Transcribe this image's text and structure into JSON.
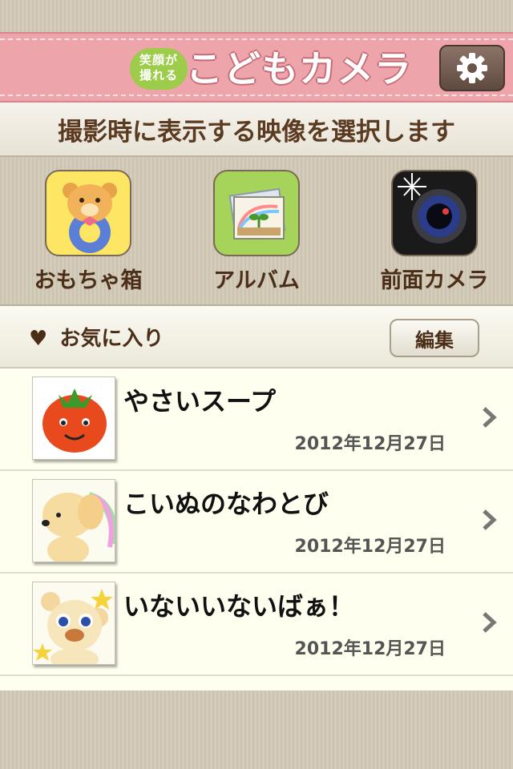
{
  "header": {
    "logo_badge": "笑顔が撮れる",
    "logo_badge_line1": "笑顔が",
    "logo_badge_line2": "撮れる",
    "app_title": "こどもカメラ"
  },
  "banner": {
    "text": "撮影時に表示する映像を選択します"
  },
  "sources": [
    {
      "label": "おもちゃ箱",
      "icon": "toybox-bear-icon"
    },
    {
      "label": "アルバム",
      "icon": "album-photos-icon"
    },
    {
      "label": "前面カメラ",
      "icon": "camera-lens-icon"
    }
  ],
  "favorites": {
    "title": "お気に入り",
    "edit_label": "編集",
    "items": [
      {
        "title": "やさいスープ",
        "date": "2012年12月27日",
        "thumb": "tomato-thumb"
      },
      {
        "title": "こいぬのなわとび",
        "date": "2012年12月27日",
        "thumb": "puppy-thumb"
      },
      {
        "title": "いないいないばぁ！",
        "date": "2012年12月27日",
        "thumb": "bear-cub-thumb"
      }
    ]
  },
  "colors": {
    "header_pink": "#eda4aa",
    "text_brown": "#4a2e18",
    "list_bg": "#fffff0"
  }
}
